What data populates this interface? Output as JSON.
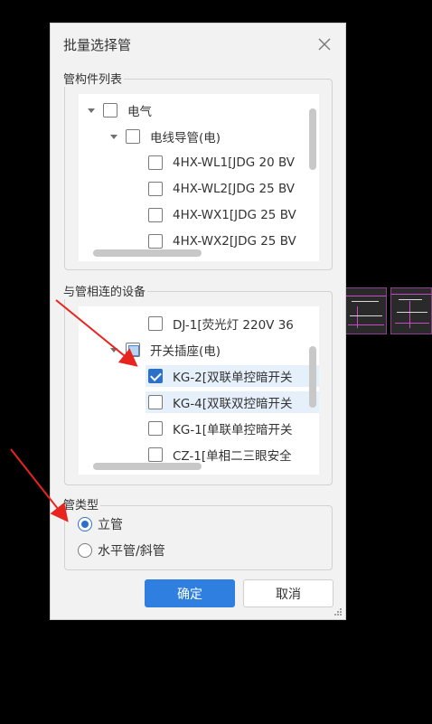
{
  "dialog": {
    "title": "批量选择管",
    "confirm_label": "确定",
    "cancel_label": "取消"
  },
  "pipe_list": {
    "label": "管构件列表",
    "items": [
      {
        "text": "电气",
        "level": 0,
        "expanded": true,
        "checked": false
      },
      {
        "text": "电线导管(电)",
        "level": 1,
        "expanded": true,
        "checked": false
      },
      {
        "text": "4HX-WL1[JDG 20 BV",
        "level": 2,
        "checked": false
      },
      {
        "text": "4HX-WL2[JDG 25 BV",
        "level": 2,
        "checked": false
      },
      {
        "text": "4HX-WX1[JDG 25 BV",
        "level": 2,
        "checked": false
      },
      {
        "text": "4HX-WX2[JDG 25 BV",
        "level": 2,
        "checked": false
      }
    ]
  },
  "devices": {
    "label": "与管相连的设备",
    "items": [
      {
        "text": "DJ-1[荧光灯 220V 36",
        "level": 2,
        "checked": false
      },
      {
        "text": "开关插座(电)",
        "level": 1,
        "expanded": true,
        "partial": true
      },
      {
        "text": "KG-2[双联单控暗开关",
        "level": 2,
        "checked": true,
        "selected": true
      },
      {
        "text": "KG-4[双联双控暗开关",
        "level": 2,
        "checked": false,
        "selected": true
      },
      {
        "text": "KG-1[单联单控暗开关",
        "level": 2,
        "checked": false
      },
      {
        "text": "CZ-1[单相二三眼安全",
        "level": 2,
        "checked": false
      }
    ]
  },
  "pipe_type": {
    "label": "管类型",
    "options": [
      "立管",
      "水平管/斜管"
    ],
    "selected": "立管"
  },
  "colors": {
    "accent": "#2f7fe0",
    "annotation_arrow": "#e8241f"
  }
}
